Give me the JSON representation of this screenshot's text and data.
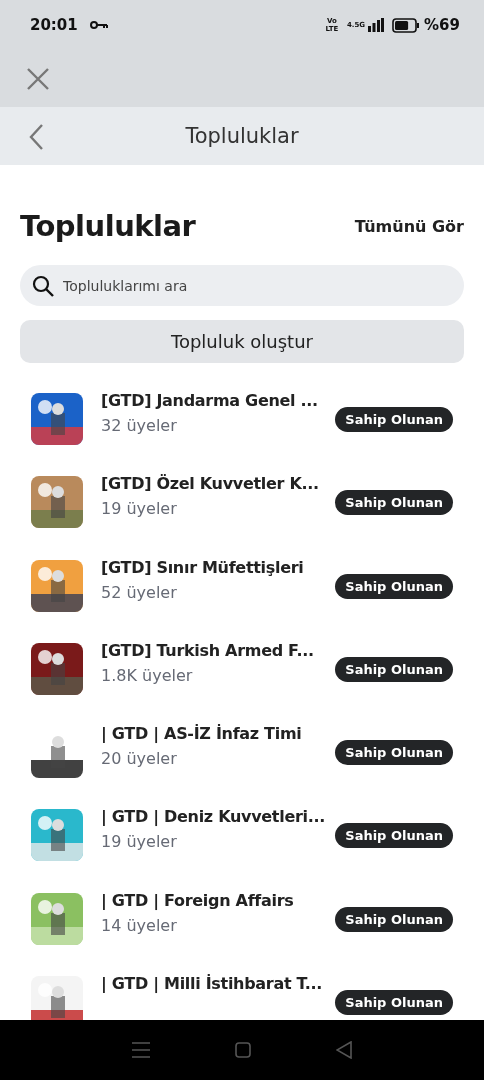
{
  "status_bar": {
    "time": "20:01",
    "volte": "Vo LTE",
    "network": "4.5G",
    "battery_text": "%69",
    "battery": {
      "level": 0.69
    }
  },
  "header": {
    "title": "Topluluklar"
  },
  "section": {
    "title": "Topluluklar",
    "see_all": "Tümünü Gör"
  },
  "search": {
    "placeholder": "Topluluklarımı ara"
  },
  "create_button": "Topluluk oluştur",
  "communities": [
    {
      "name": "[GTD] Jandarma Genel ...",
      "members": "32 üyeler",
      "badge": "Sahip Olunan"
    },
    {
      "name": "[GTD] Özel Kuvvetler K...",
      "members": "19 üyeler",
      "badge": "Sahip Olunan"
    },
    {
      "name": "[GTD] Sınır Müfettişleri",
      "members": "52 üyeler",
      "badge": "Sahip Olunan"
    },
    {
      "name": "[GTD] Turkish Armed F...",
      "members": "1.8K üyeler",
      "badge": "Sahip Olunan"
    },
    {
      "name": "| GTD | AS-İZ İnfaz Timi",
      "members": "20 üyeler",
      "badge": "Sahip Olunan"
    },
    {
      "name": "| GTD | Deniz Kuvvetleri...",
      "members": "19 üyeler",
      "badge": "Sahip Olunan"
    },
    {
      "name": "| GTD | Foreign Affairs",
      "members": "14 üyeler",
      "badge": "Sahip Olunan"
    },
    {
      "name": "| GTD | Milli İstihbarat T...",
      "badge": "Sahip Olunan"
    }
  ]
}
